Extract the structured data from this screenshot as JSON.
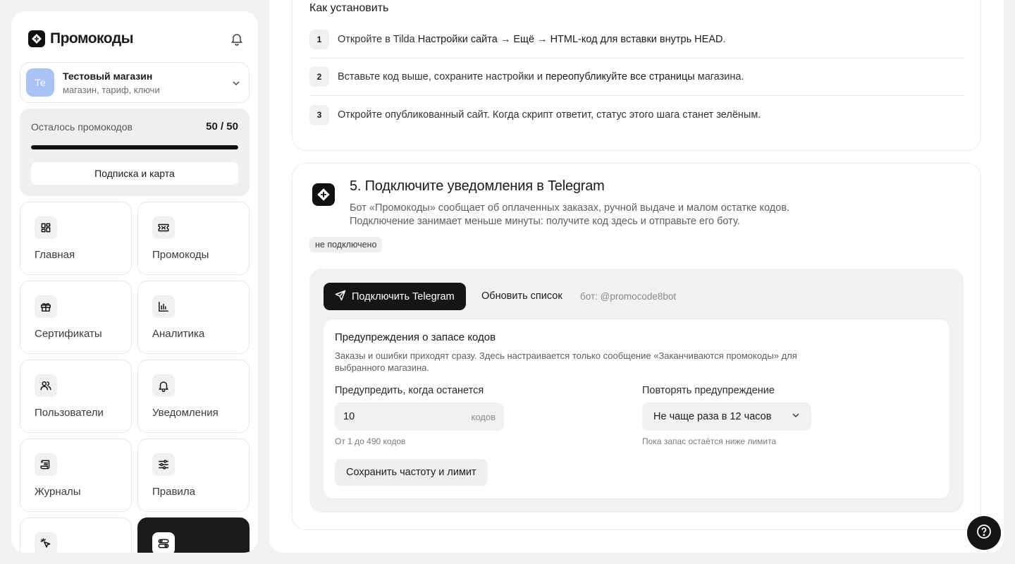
{
  "sidebar": {
    "brand": "Промокоды",
    "store": {
      "avatar": "Те",
      "name": "Тестовый магазин",
      "subtitle": "магазин, тариф, ключи"
    },
    "quota": {
      "label": "Осталось промокодов",
      "value": "50 / 50",
      "fraction": 1.0,
      "button": "Подписка и карта"
    },
    "nav": [
      {
        "label": "Главная",
        "icon": "dashboard-icon"
      },
      {
        "label": "Промокоды",
        "icon": "ticket-icon"
      },
      {
        "label": "Сертификаты",
        "icon": "gift-icon"
      },
      {
        "label": "Аналитика",
        "icon": "bar-chart-icon"
      },
      {
        "label": "Пользователи",
        "icon": "users-icon"
      },
      {
        "label": "Уведомления",
        "icon": "bell-icon"
      },
      {
        "label": "Журналы",
        "icon": "scroll-icon"
      },
      {
        "label": "Правила",
        "icon": "sliders-icon"
      },
      {
        "label": "",
        "icon": "click-icon"
      },
      {
        "label": "",
        "icon": "settings-toggle-icon",
        "active": true
      }
    ]
  },
  "install": {
    "title": "Как установить",
    "steps": [
      {
        "num": "1",
        "pre": "Откройте в Tilda ",
        "bold": "Настройки сайта → Ещё → HTML-код для вставки внутрь HEAD",
        "post": "."
      },
      {
        "num": "2",
        "pre": "Вставьте код выше, сохраните настройки и ",
        "bold": "переопубликуйте все страницы",
        "post": " магазина."
      },
      {
        "num": "3",
        "pre": "Откройте опубликованный сайт. Когда скрипт ответит, статус этого шага станет зелёным.",
        "bold": "",
        "post": ""
      }
    ]
  },
  "telegram": {
    "title": "5. Подключите уведомления в Telegram",
    "desc": "Бот «Промокоды» сообщает об оплаченных заказах, ручной выдаче и малом остатке кодов. Подключение занимает меньше минуты: получите код здесь и отправьте его боту.",
    "status": "не подключено",
    "connect_label": "Подключить Telegram",
    "refresh_label": "Обновить список",
    "bot_label": "бот: @promocode8bot",
    "warnings": {
      "title": "Предупреждения о запасе кодов",
      "desc": "Заказы и ошибки приходят сразу. Здесь настраивается только сообщение «Заканчиваются промокоды» для выбранного магазина.",
      "threshold_label": "Предупредить, когда останется",
      "threshold_value": "10",
      "threshold_unit": "кодов",
      "threshold_hint": "От 1 до 490 кодов",
      "repeat_label": "Повторять предупреждение",
      "repeat_value": "Не чаще раза в 12 часов",
      "repeat_hint": "Пока запас остаётся ниже лимита",
      "save_label": "Сохранить частоту и лимит"
    }
  },
  "colors": {
    "accent": "#151515",
    "avatar": "#a9c3f6",
    "panel": "#f1f1f2"
  }
}
